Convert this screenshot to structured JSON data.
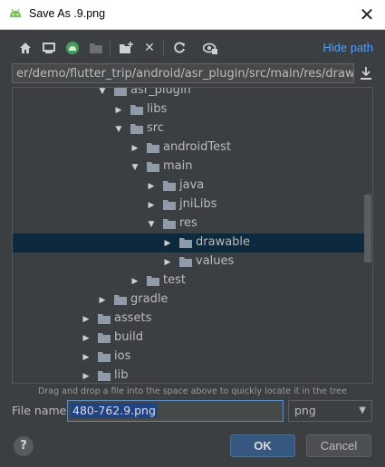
{
  "window": {
    "title": "Save As .9.png"
  },
  "toolbar": {
    "icons": [
      "home-icon",
      "desktop-icon",
      "android-project-icon",
      "new-folder-disabled-icon",
      "new-folder-icon",
      "delete-icon",
      "refresh-icon",
      "show-hidden-icon"
    ],
    "hide_path_label": "Hide path"
  },
  "path": {
    "value": "er/demo/flutter_trip/android/asr_plugin/src/main/res/drawable"
  },
  "tree": {
    "items": [
      {
        "label": "asr_plugin",
        "expanded": true
      },
      {
        "label": "libs",
        "expanded": false
      },
      {
        "label": "src",
        "expanded": true
      },
      {
        "label": "androidTest",
        "expanded": false
      },
      {
        "label": "main",
        "expanded": true
      },
      {
        "label": "java",
        "expanded": false
      },
      {
        "label": "jniLibs",
        "expanded": false
      },
      {
        "label": "res",
        "expanded": true
      },
      {
        "label": "drawable",
        "expanded": false,
        "selected": true
      },
      {
        "label": "values",
        "expanded": false
      },
      {
        "label": "test",
        "expanded": false
      },
      {
        "label": "gradle",
        "expanded": false
      },
      {
        "label": "assets",
        "expanded": false
      },
      {
        "label": "build",
        "expanded": false
      },
      {
        "label": "ios",
        "expanded": false
      },
      {
        "label": "lib",
        "expanded": false
      }
    ]
  },
  "hint": "Drag and drop a file into the space above to quickly locate it in the tree",
  "file": {
    "label": "File name:",
    "value": "480-762.9.png"
  },
  "ext": {
    "value": "png"
  },
  "buttons": {
    "ok": "OK",
    "cancel": "Cancel",
    "help": "?"
  }
}
